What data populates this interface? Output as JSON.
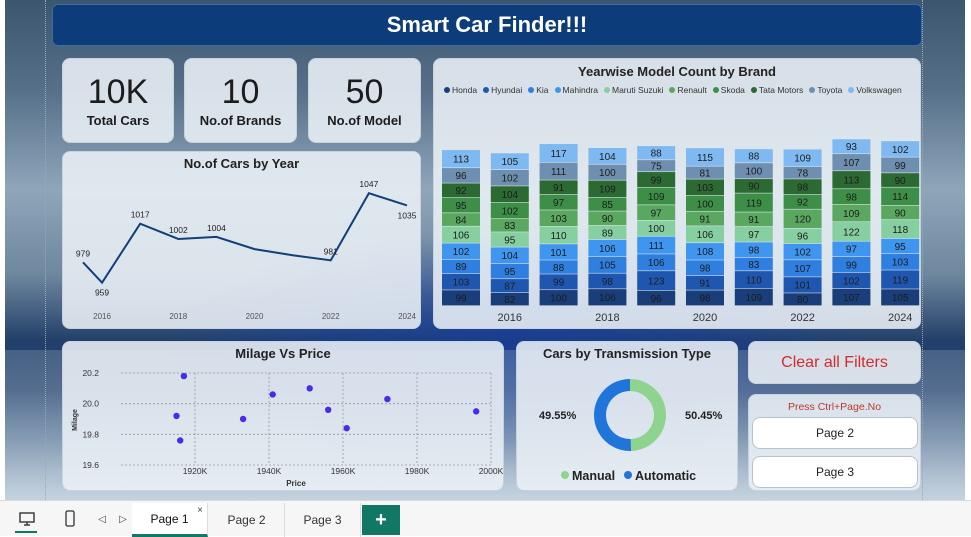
{
  "header": {
    "title": "Smart Car Finder!!!"
  },
  "kpis": [
    {
      "value": "10K",
      "label": "Total Cars"
    },
    {
      "value": "10",
      "label": "No.of Brands"
    },
    {
      "value": "50",
      "label": "No.of Model"
    }
  ],
  "cars_by_year": {
    "title": "No.of Cars by Year",
    "data_labels": [
      "979",
      "959",
      "1017",
      "1002",
      "1004",
      "981",
      "1047",
      "1035"
    ]
  },
  "brand_chart": {
    "title": "Yearwise Model Count by Brand"
  },
  "mileage_price": {
    "title": "Milage Vs Price",
    "xlabel": "Price",
    "ylabel": "Milage"
  },
  "transmission": {
    "title": "Cars by Transmission Type",
    "manual_label": "49.55%",
    "automatic_label": "50.45%",
    "legend_manual": "Manual",
    "legend_automatic": "Automatic"
  },
  "clear_filters": {
    "label": "Clear all Filters"
  },
  "navigation": {
    "hint": "Press Ctrl+Page.No",
    "page2": "Page 2",
    "page3": "Page 3"
  },
  "bottom_tabs": [
    "Page 1",
    "Page 2",
    "Page 3"
  ],
  "colors": {
    "line": "#123f7a",
    "manual": "#8ed38e",
    "automatic": "#1f75d9",
    "scatter": "#4a2bea",
    "clear_text": "#d62b2b"
  },
  "chart_data": [
    {
      "type": "line",
      "title": "No.of Cars by Year",
      "x": [
        2016,
        2017,
        2018,
        2019,
        2020,
        2021,
        2022,
        2023,
        2024
      ],
      "values": [
        979,
        959,
        1017,
        1002,
        1004,
        992,
        986,
        981,
        1047,
        1035
      ],
      "x_points": [
        2015.5,
        2016,
        2017,
        2018,
        2019,
        2020,
        2021,
        2022,
        2023,
        2024
      ],
      "tick_labels": [
        "2016",
        "2018",
        "2020",
        "2022",
        "2024"
      ],
      "ylim": [
        940,
        1060
      ]
    },
    {
      "type": "bar",
      "stacked": true,
      "title": "Yearwise Model Count by Brand",
      "categories": [
        "2015",
        "2016",
        "2017",
        "2018",
        "2019",
        "2020",
        "2021",
        "2022",
        "2023",
        "2024"
      ],
      "tick_labels": [
        "2016",
        "2018",
        "2020",
        "2022",
        "2024"
      ],
      "legend_position": "top",
      "series": [
        {
          "name": "Honda",
          "color": "#1a3e79",
          "values": [
            99,
            82,
            100,
            106,
            96,
            98,
            109,
            80,
            107,
            105
          ]
        },
        {
          "name": "Hyundai",
          "color": "#1f57b0",
          "values": [
            103,
            87,
            99,
            98,
            123,
            91,
            110,
            101,
            102,
            119
          ]
        },
        {
          "name": "Kia",
          "color": "#2f7fe0",
          "values": [
            89,
            95,
            88,
            105,
            106,
            98,
            83,
            107,
            99,
            103
          ]
        },
        {
          "name": "Mahindra",
          "color": "#3f96f0",
          "values": [
            102,
            104,
            101,
            106,
            111,
            108,
            98,
            102,
            97,
            95
          ]
        },
        {
          "name": "Maruti Suzuki",
          "color": "#86cfa0",
          "values": [
            106,
            95,
            110,
            89,
            100,
            106,
            97,
            96,
            122,
            118
          ]
        },
        {
          "name": "Renault",
          "color": "#5aa860",
          "values": [
            84,
            83,
            103,
            90,
            97,
            91,
            91,
            120,
            109,
            90
          ]
        },
        {
          "name": "Skoda",
          "color": "#3d8f47",
          "values": [
            95,
            102,
            97,
            85,
            109,
            100,
            119,
            92,
            98,
            114
          ]
        },
        {
          "name": "Tata Motors",
          "color": "#2c6a33",
          "values": [
            92,
            104,
            91,
            109,
            99,
            103,
            90,
            98,
            113,
            90
          ]
        },
        {
          "name": "Toyota",
          "color": "#6f8fb0",
          "values": [
            96,
            102,
            111,
            100,
            75,
            81,
            100,
            78,
            107,
            99
          ]
        },
        {
          "name": "Volkswagen",
          "color": "#7fb9f2",
          "values": [
            113,
            105,
            117,
            104,
            88,
            115,
            88,
            109,
            93,
            102
          ]
        }
      ]
    },
    {
      "type": "scatter",
      "title": "Milage Vs Price",
      "xlabel": "Price",
      "ylabel": "Milage",
      "xlim": [
        1900000,
        2000000
      ],
      "ylim": [
        19.6,
        20.2
      ],
      "x_tick_labels": [
        "1920K",
        "1940K",
        "1960K",
        "1980K",
        "2000K"
      ],
      "y_tick_labels": [
        "20.2",
        "20.0",
        "19.8",
        "19.6"
      ],
      "points": [
        {
          "x": 1917000,
          "y": 20.18
        },
        {
          "x": 1915000,
          "y": 19.92
        },
        {
          "x": 1916000,
          "y": 19.76
        },
        {
          "x": 1933000,
          "y": 19.9
        },
        {
          "x": 1941000,
          "y": 20.06
        },
        {
          "x": 1951000,
          "y": 20.1
        },
        {
          "x": 1956000,
          "y": 19.96
        },
        {
          "x": 1961000,
          "y": 19.84
        },
        {
          "x": 1972000,
          "y": 20.03
        },
        {
          "x": 1996000,
          "y": 19.95
        }
      ]
    },
    {
      "type": "pie",
      "donut": true,
      "title": "Cars by Transmission Type",
      "categories": [
        "Manual",
        "Automatic"
      ],
      "values": [
        49.55,
        50.45
      ],
      "legend_position": "bottom"
    }
  ]
}
